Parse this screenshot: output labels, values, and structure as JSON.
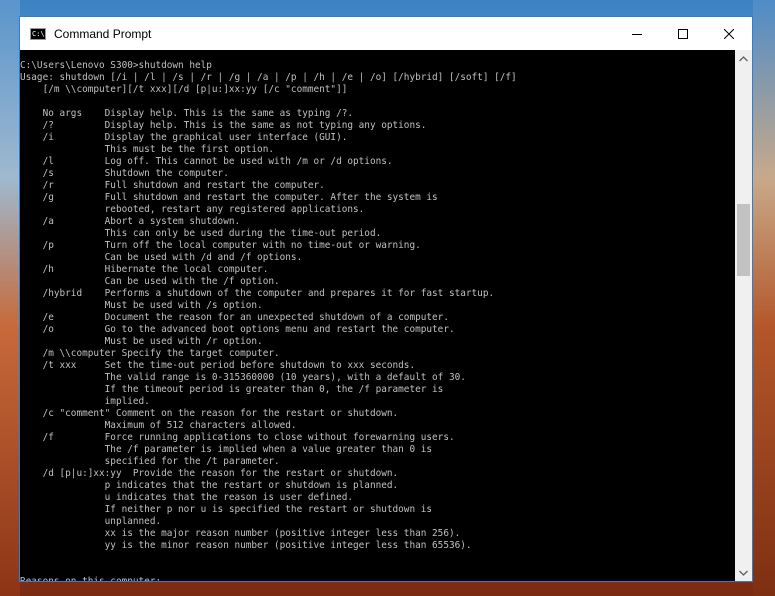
{
  "window": {
    "title": "Command Prompt",
    "icon_text": "C:\\"
  },
  "console": {
    "lines": [
      "C:\\Users\\Lenovo S300>shutdown help",
      "Usage: shutdown [/i | /l | /s | /r | /g | /a | /p | /h | /e | /o] [/hybrid] [/soft] [/f]",
      "    [/m \\\\computer][/t xxx][/d [p|u:]xx:yy [/c \"comment\"]]",
      "",
      "    No args    Display help. This is the same as typing /?.",
      "    /?         Display help. This is the same as not typing any options.",
      "    /i         Display the graphical user interface (GUI).",
      "               This must be the first option.",
      "    /l         Log off. This cannot be used with /m or /d options.",
      "    /s         Shutdown the computer.",
      "    /r         Full shutdown and restart the computer.",
      "    /g         Full shutdown and restart the computer. After the system is",
      "               rebooted, restart any registered applications.",
      "    /a         Abort a system shutdown.",
      "               This can only be used during the time-out period.",
      "    /p         Turn off the local computer with no time-out or warning.",
      "               Can be used with /d and /f options.",
      "    /h         Hibernate the local computer.",
      "               Can be used with the /f option.",
      "    /hybrid    Performs a shutdown of the computer and prepares it for fast startup.",
      "               Must be used with /s option.",
      "    /e         Document the reason for an unexpected shutdown of a computer.",
      "    /o         Go to the advanced boot options menu and restart the computer.",
      "               Must be used with /r option.",
      "    /m \\\\computer Specify the target computer.",
      "    /t xxx     Set the time-out period before shutdown to xxx seconds.",
      "               The valid range is 0-315360000 (10 years), with a default of 30.",
      "               If the timeout period is greater than 0, the /f parameter is",
      "               implied.",
      "    /c \"comment\" Comment on the reason for the restart or shutdown.",
      "               Maximum of 512 characters allowed.",
      "    /f         Force running applications to close without forewarning users.",
      "               The /f parameter is implied when a value greater than 0 is",
      "               specified for the /t parameter.",
      "    /d [p|u:]xx:yy  Provide the reason for the restart or shutdown.",
      "               p indicates that the restart or shutdown is planned.",
      "               u indicates that the reason is user defined.",
      "               If neither p nor u is specified the restart or shutdown is",
      "               unplanned.",
      "               xx is the major reason number (positive integer less than 256).",
      "               yy is the minor reason number (positive integer less than 65536).",
      "",
      "",
      "Reasons on this computer:"
    ]
  },
  "icons": {
    "minimize": "minimize-icon",
    "maximize": "maximize-icon",
    "close": "close-icon",
    "scroll_up": "chevron-up-icon",
    "scroll_down": "chevron-down-icon"
  }
}
